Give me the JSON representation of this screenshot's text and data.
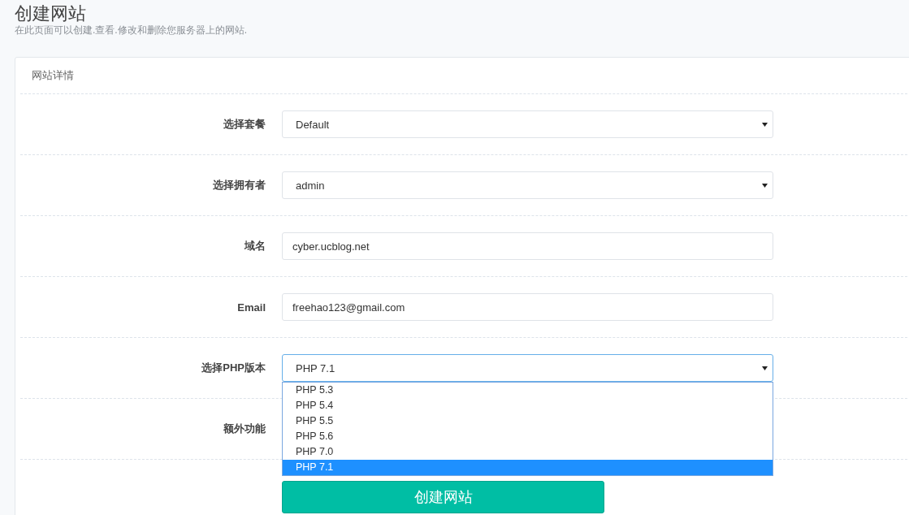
{
  "page": {
    "title": "创建网站",
    "subtitle": "在此页面可以创建.查看.修改和删除您服务器上的网站."
  },
  "card": {
    "title": "网站详情"
  },
  "fields": [
    {
      "kind": "select",
      "label": "选择套餐",
      "value": "Default",
      "expanded": false
    },
    {
      "kind": "select",
      "label": "选择拥有者",
      "value": "admin",
      "expanded": false
    },
    {
      "kind": "input",
      "label": "域名",
      "value": "cyber.ucblog.net"
    },
    {
      "kind": "input",
      "label": "Email",
      "value": "freehao123@gmail.com"
    },
    {
      "kind": "select",
      "label": "选择PHP版本",
      "value": "PHP 7.1",
      "expanded": true,
      "options": [
        {
          "label": "PHP 5.3",
          "selected": false
        },
        {
          "label": "PHP 5.4",
          "selected": false
        },
        {
          "label": "PHP 5.5",
          "selected": false
        },
        {
          "label": "PHP 5.6",
          "selected": false
        },
        {
          "label": "PHP 7.0",
          "selected": false
        },
        {
          "label": "PHP 7.1",
          "selected": true
        }
      ]
    },
    {
      "kind": "blank",
      "label": "额外功能"
    }
  ],
  "submit_button": {
    "label": "创建网站"
  }
}
